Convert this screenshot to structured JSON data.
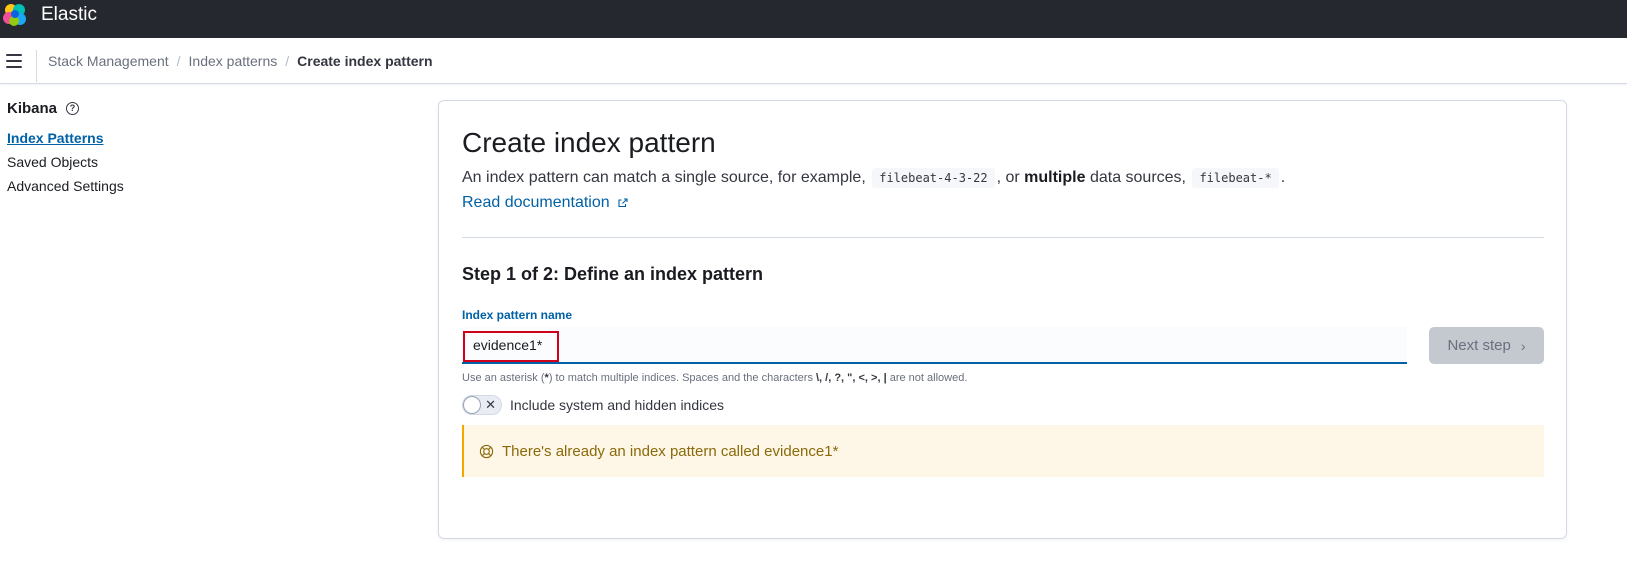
{
  "header": {
    "brand": "Elastic"
  },
  "breadcrumbs": [
    {
      "label": "Stack Management"
    },
    {
      "label": "Index patterns"
    },
    {
      "label": "Create index pattern"
    }
  ],
  "sidebar": {
    "title": "Kibana",
    "items": [
      {
        "label": "Index Patterns",
        "active": true
      },
      {
        "label": "Saved Objects",
        "active": false
      },
      {
        "label": "Advanced Settings",
        "active": false
      }
    ]
  },
  "main": {
    "title": "Create index pattern",
    "description": {
      "part1": "An index pattern can match a single source, for example, ",
      "code1": "filebeat-4-3-22",
      "part2": ", or ",
      "bold": "multiple",
      "part3": " data sources, ",
      "code2": "filebeat-*",
      "part4": "."
    },
    "doc_link": "Read documentation",
    "step_title": "Step 1 of 2: Define an index pattern",
    "field_label": "Index pattern name",
    "input_value": "evidence1*",
    "next_button": "Next step",
    "help_text": {
      "part1": "Use an asterisk (",
      "star": "*",
      "part2": ") to match multiple indices. Spaces and the characters ",
      "chars": "\\, /, ?, \", <, >, |",
      "part3": " are not allowed."
    },
    "toggle_label": "Include system and hidden indices",
    "toggle_on": false,
    "callout_text": "There's already an index pattern called evidence1*"
  },
  "colors": {
    "header_bg": "#25282f",
    "link": "#0061a6",
    "callout_bg": "#fef6e6",
    "callout_border": "#f5a700",
    "callout_text": "#8a6a0a",
    "highlight": "#d0021b"
  },
  "icons": {
    "logo": "elastic-logo",
    "menu": "hamburger-menu-icon",
    "help": "question-circle-icon",
    "external": "external-link-icon",
    "chevron": "chevron-right-icon",
    "toggle_x": "cross-icon",
    "callout": "lifebuoy-icon"
  }
}
